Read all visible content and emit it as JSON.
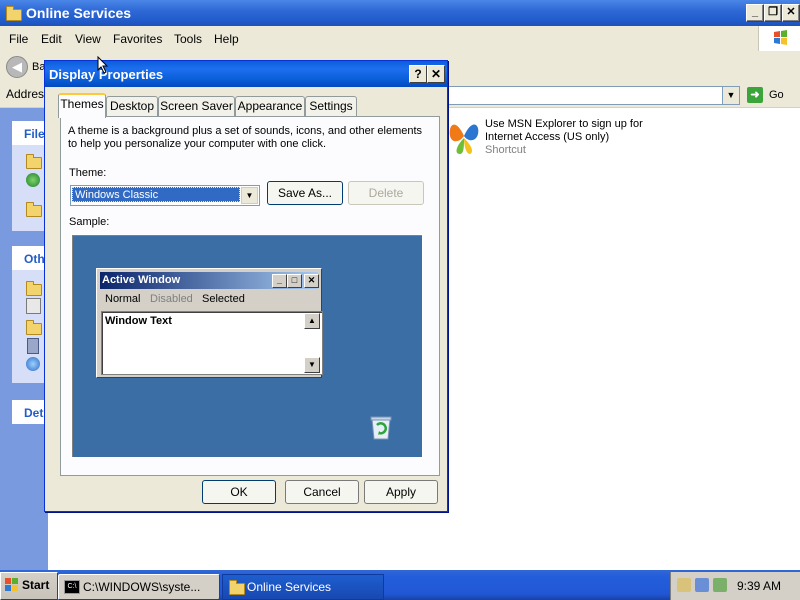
{
  "window": {
    "title": "Online Services"
  },
  "menu": [
    "File",
    "Edit",
    "View",
    "Favorites",
    "Tools",
    "Help"
  ],
  "toolbar": {
    "back_label_partial": "Ba"
  },
  "address": {
    "label": "Address",
    "go_label": "Go"
  },
  "task_pane": {
    "sections": [
      {
        "title_partial": "File"
      },
      {
        "title_partial": "Oth"
      },
      {
        "title_partial": "Det"
      }
    ]
  },
  "content": {
    "item": {
      "line1": "Use MSN Explorer to sign up for",
      "line2": "Internet Access (US only)",
      "type": "Shortcut"
    }
  },
  "dialog": {
    "title": "Display Properties",
    "help_btn": "?",
    "close_btn": "✕",
    "tabs": [
      "Themes",
      "Desktop",
      "Screen Saver",
      "Appearance",
      "Settings"
    ],
    "active_tab": "Themes",
    "description": "A theme is a background plus a set of sounds, icons, and other elements to help you personalize your computer with one click.",
    "description_line1": "A theme is a background plus a set of sounds, icons, and other elements",
    "description_line2": "to help you personalize your computer with one click.",
    "theme_label": "Theme:",
    "theme_value": "Windows Classic",
    "save_as": "Save As...",
    "delete": "Delete",
    "sample_label": "Sample:",
    "sample": {
      "window_title": "Active Window",
      "menu_normal": "Normal",
      "menu_disabled": "Disabled",
      "menu_selected": "Selected",
      "window_text": "Window Text"
    },
    "ok": "OK",
    "cancel": "Cancel",
    "apply": "Apply"
  },
  "taskbar": {
    "start": "Start",
    "tasks": [
      "C:\\WINDOWS\\syste...",
      "Online Services"
    ],
    "clock": "9:39 AM"
  },
  "colors": {
    "title_blue": "#245fcf",
    "desktop_sample": "#3a6ea5",
    "taskbar_blue": "#245edb"
  }
}
